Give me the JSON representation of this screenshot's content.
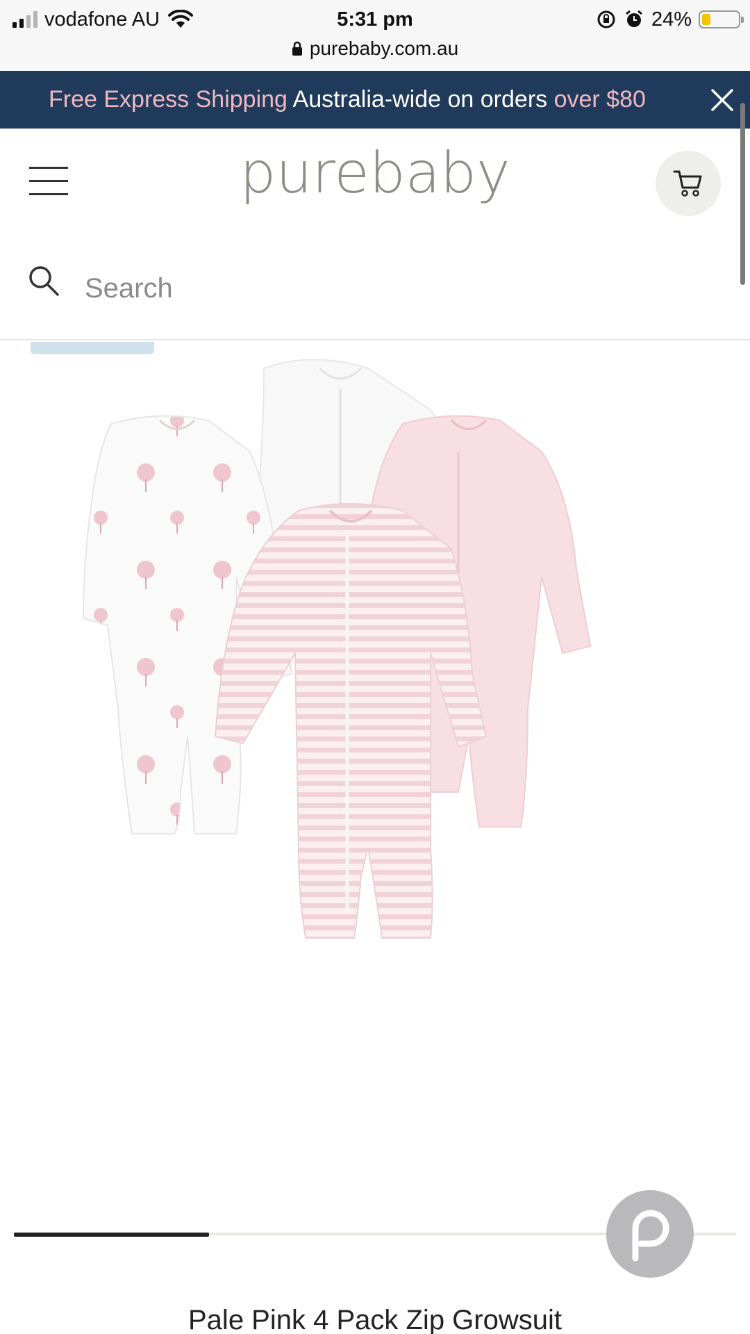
{
  "status_bar": {
    "carrier": "vodafone AU",
    "time": "5:31 pm",
    "battery": "24%",
    "battery_level": 0.24,
    "url": "purebaby.com.au"
  },
  "promo_banner": {
    "highlight_1": "Free Express Shipping",
    "middle": " Australia-wide on orders ",
    "highlight_2": "over $80"
  },
  "header": {
    "logo_text": "purebaby",
    "search_placeholder": "Search"
  },
  "gallery": {
    "slide_progress": 0.27
  },
  "product": {
    "title": "Pale Pink 4 Pack Zip Growsuit"
  },
  "icons": {
    "menu": "hamburger-icon",
    "cart": "cart-icon",
    "search": "search-icon",
    "close": "close-icon",
    "lock": "lock-icon",
    "chat": "chat-icon"
  },
  "colors": {
    "banner_bg": "#1f3a5a",
    "banner_highlight": "#f2b8c2",
    "logo": "#8f8b86"
  }
}
